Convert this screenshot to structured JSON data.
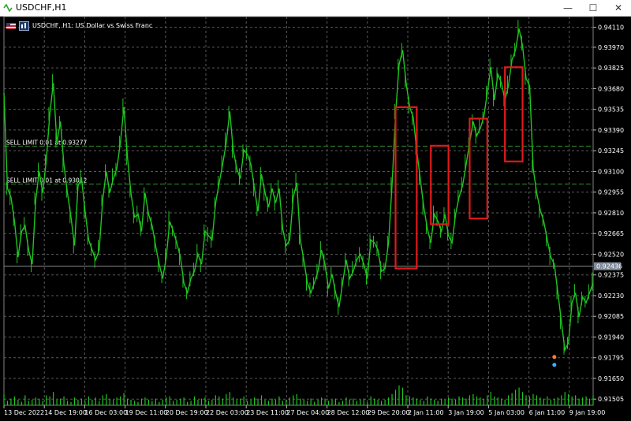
{
  "window": {
    "title": "USDCHF,H1",
    "minimize_glyph": "—",
    "maximize_glyph": "☐",
    "close_glyph": "✕"
  },
  "info_bar": {
    "symbol_text": "USDCHF, H1:  US Dollar vs Swiss Franc",
    "flag_icon": "us-flag-icon",
    "trade_icon": "one-click-trading-icon"
  },
  "orders": [
    {
      "label": "SELL LIMIT 0.01 at 0.93277",
      "price": 0.93277
    },
    {
      "label": "SELL LIMIT 0.01 at 0.93012",
      "price": 0.93012
    }
  ],
  "current_price": {
    "label": "0.92436",
    "value": 0.92436
  },
  "chart_data": {
    "type": "line",
    "ylim": [
      0.91462,
      0.94185
    ],
    "y_ticks": [
      "0.94110",
      "0.93970",
      "0.93825",
      "0.93680",
      "0.93535",
      "0.93390",
      "0.93245",
      "0.93100",
      "0.92955",
      "0.92810",
      "0.92665",
      "0.92520",
      "0.92375",
      "0.92230",
      "0.92085",
      "0.91940",
      "0.91795",
      "0.91650",
      "0.91505"
    ],
    "x_ticks": [
      "13 Dec 2022",
      "14 Dec 19:00",
      "16 Dec 03:00",
      "19 Dec 11:00",
      "20 Dec 19:00",
      "22 Dec 03:00",
      "23 Dec 11:00",
      "27 Dec 04:00",
      "28 Dec 12:00",
      "29 Dec 20:00",
      "2 Jan 11:00",
      "3 Jan 19:00",
      "5 Jan 03:00",
      "6 Jan 11:00",
      "9 Jan 19:00"
    ],
    "series": [
      {
        "values": [
          0.9365,
          0.9298,
          0.9292,
          0.9275,
          0.925,
          0.9268,
          0.9272,
          0.9255,
          0.9245,
          0.929,
          0.931,
          0.9295,
          0.9318,
          0.935,
          0.9372,
          0.933,
          0.9345,
          0.9315,
          0.9295,
          0.9278,
          0.9258,
          0.93,
          0.9305,
          0.9282,
          0.9262,
          0.9255,
          0.9248,
          0.9255,
          0.929,
          0.931,
          0.9295,
          0.9305,
          0.9312,
          0.933,
          0.9355,
          0.932,
          0.9295,
          0.9278,
          0.928,
          0.9268,
          0.9295,
          0.928,
          0.9272,
          0.9258,
          0.9245,
          0.9235,
          0.925,
          0.9275,
          0.9268,
          0.926,
          0.925,
          0.9232,
          0.9225,
          0.9235,
          0.924,
          0.9252,
          0.9245,
          0.9268,
          0.9265,
          0.9262,
          0.9288,
          0.9302,
          0.9315,
          0.933,
          0.9352,
          0.9325,
          0.9312,
          0.9305,
          0.9325,
          0.9322,
          0.9315,
          0.9298,
          0.9282,
          0.9308,
          0.9295,
          0.9285,
          0.9298,
          0.9288,
          0.9298,
          0.927,
          0.9258,
          0.9262,
          0.9292,
          0.9302,
          0.9262,
          0.9248,
          0.9232,
          0.9225,
          0.9232,
          0.924,
          0.9255,
          0.9245,
          0.9228,
          0.9238,
          0.9225,
          0.9215,
          0.9232,
          0.9248,
          0.9235,
          0.924,
          0.9248,
          0.9252,
          0.9245,
          0.9235,
          0.9262,
          0.926,
          0.9255,
          0.924,
          0.9242,
          0.926,
          0.93,
          0.935,
          0.9385,
          0.9395,
          0.9372,
          0.9355,
          0.9348,
          0.9325,
          0.9305,
          0.9285,
          0.927,
          0.926,
          0.928,
          0.9275,
          0.9268,
          0.928,
          0.9265,
          0.926,
          0.928,
          0.9292,
          0.93,
          0.9315,
          0.933,
          0.9345,
          0.9335,
          0.934,
          0.9348,
          0.9365,
          0.9383,
          0.936,
          0.9378,
          0.9372,
          0.936,
          0.937,
          0.9388,
          0.9395,
          0.941,
          0.9398,
          0.9375,
          0.937,
          0.9312,
          0.9295,
          0.9283,
          0.9275,
          0.9262,
          0.925,
          0.9245,
          0.9225,
          0.9205,
          0.9185,
          0.919,
          0.9218,
          0.9225,
          0.9208,
          0.9222,
          0.9218,
          0.9225,
          0.9232
        ]
      }
    ],
    "volume": [
      10,
      4,
      6,
      8,
      5,
      3,
      9,
      4,
      5,
      7,
      6,
      4,
      9,
      8,
      12,
      5,
      6,
      8,
      4,
      3,
      7,
      5,
      6,
      4,
      8,
      5,
      7,
      4,
      9,
      10,
      6,
      5,
      7,
      8,
      11,
      6,
      5,
      4,
      3,
      6,
      7,
      5,
      4,
      6,
      3,
      5,
      7,
      8,
      4,
      5,
      6,
      7,
      3,
      4,
      8,
      5,
      6,
      7,
      4,
      5,
      9,
      8,
      6,
      10,
      12,
      7,
      5,
      6,
      8,
      4,
      5,
      7,
      6,
      9,
      5,
      4,
      6,
      5,
      8,
      4,
      5,
      7,
      9,
      10,
      6,
      5,
      4,
      6,
      3,
      5,
      7,
      6,
      4,
      5,
      6,
      3,
      4,
      7,
      5,
      6,
      4,
      5,
      6,
      3,
      8,
      6,
      5,
      4,
      5,
      7,
      10,
      14,
      18,
      16,
      9,
      8,
      7,
      6,
      5,
      4,
      8,
      6,
      5,
      4,
      6,
      5,
      7,
      6,
      5,
      8,
      7,
      6,
      9,
      10,
      8,
      7,
      6,
      9,
      12,
      8,
      7,
      6,
      5,
      9,
      11,
      14,
      16,
      12,
      9,
      8,
      10,
      9,
      7,
      6,
      8,
      5,
      6,
      7,
      9,
      12,
      10,
      8,
      9,
      6,
      7,
      8,
      6,
      9
    ],
    "rectangles": [
      {
        "from_index": 111,
        "to_index": 117,
        "high": 0.9355,
        "low": 0.9242
      },
      {
        "from_index": 121,
        "to_index": 126,
        "high": 0.9328,
        "low": 0.9273
      },
      {
        "from_index": 132,
        "to_index": 137,
        "high": 0.9347,
        "low": 0.9277
      },
      {
        "from_index": 142,
        "to_index": 147,
        "high": 0.9383,
        "low": 0.9317
      }
    ],
    "grid": true,
    "line_color": "#1fc61f",
    "grid_color": "#5a5a5a",
    "order_line_color": "#2e8b2e",
    "rect_color": "#e01a1a",
    "background": "#000000"
  }
}
